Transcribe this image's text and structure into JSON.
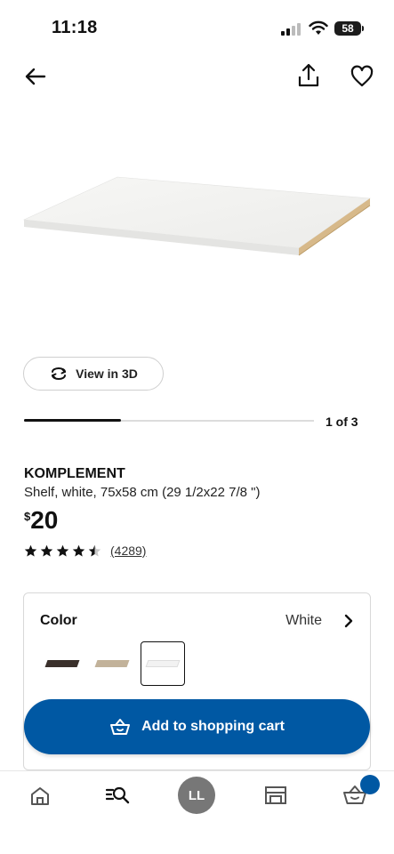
{
  "status_bar": {
    "time": "11:18",
    "battery": "58"
  },
  "header": {
    "back_icon": "arrow-left-icon",
    "share_icon": "share-icon",
    "favorite_icon": "heart-icon"
  },
  "gallery": {
    "view_3d_label": "View in 3D",
    "progress_fraction": 0.333,
    "page_indicator": "1 of 3"
  },
  "product": {
    "name": "KOMPLEMENT",
    "description": "Shelf, white, 75x58 cm (29 1/2x22 7/8 \")",
    "price_currency": "$",
    "price_amount": "20",
    "rating": 4.5,
    "review_count": "(4289)"
  },
  "color_selector": {
    "label": "Color",
    "selected_value": "White",
    "options": [
      {
        "name": "Black-brown",
        "color": "#3a302b"
      },
      {
        "name": "Beige oak effect",
        "color": "#c2b29a"
      },
      {
        "name": "White",
        "color": "#f2f2f2"
      }
    ],
    "selected_index": 2
  },
  "cart": {
    "button_label": "Add to shopping cart"
  },
  "bottom_nav": {
    "items": [
      "home-icon",
      "search-list-icon",
      "profile-avatar",
      "store-icon",
      "cart-icon"
    ],
    "profile_initials": "LL"
  },
  "colors": {
    "brand_blue": "#0058a3",
    "text": "#111111"
  }
}
